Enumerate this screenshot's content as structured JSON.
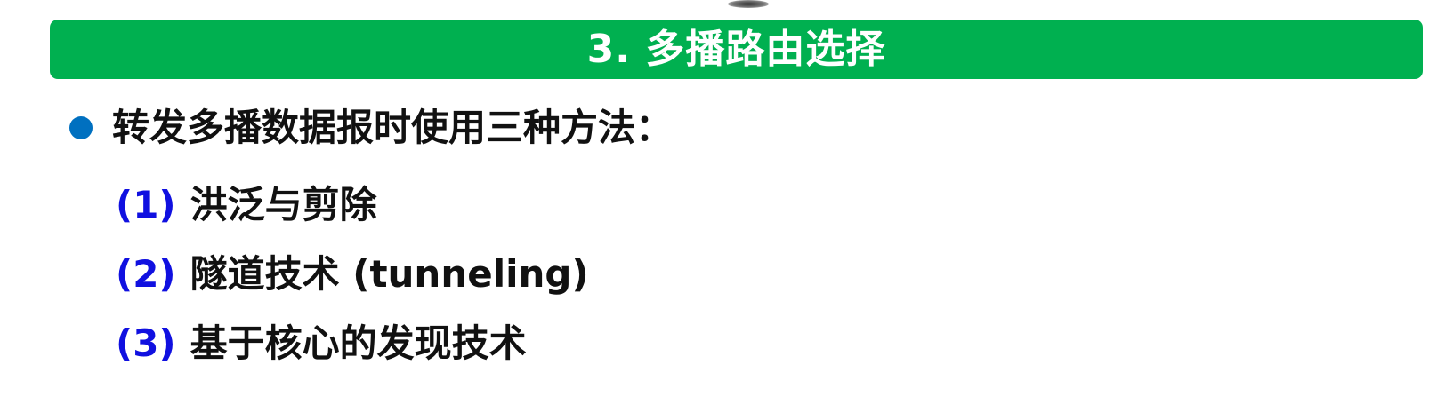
{
  "header": {
    "title": "3. 多播路由选择"
  },
  "main": {
    "bullet": "转发多播数据报时使用三种方法：",
    "items": [
      {
        "number": "(1)",
        "text": "洪泛与剪除"
      },
      {
        "number": "(2)",
        "text": "隧道技术 (tunneling)"
      },
      {
        "number": "(3)",
        "text": "基于核心的发现技术"
      }
    ]
  },
  "colors": {
    "title_bar": "#00b050",
    "bullet_dot": "#0070c0",
    "item_number": "#1010e0"
  }
}
